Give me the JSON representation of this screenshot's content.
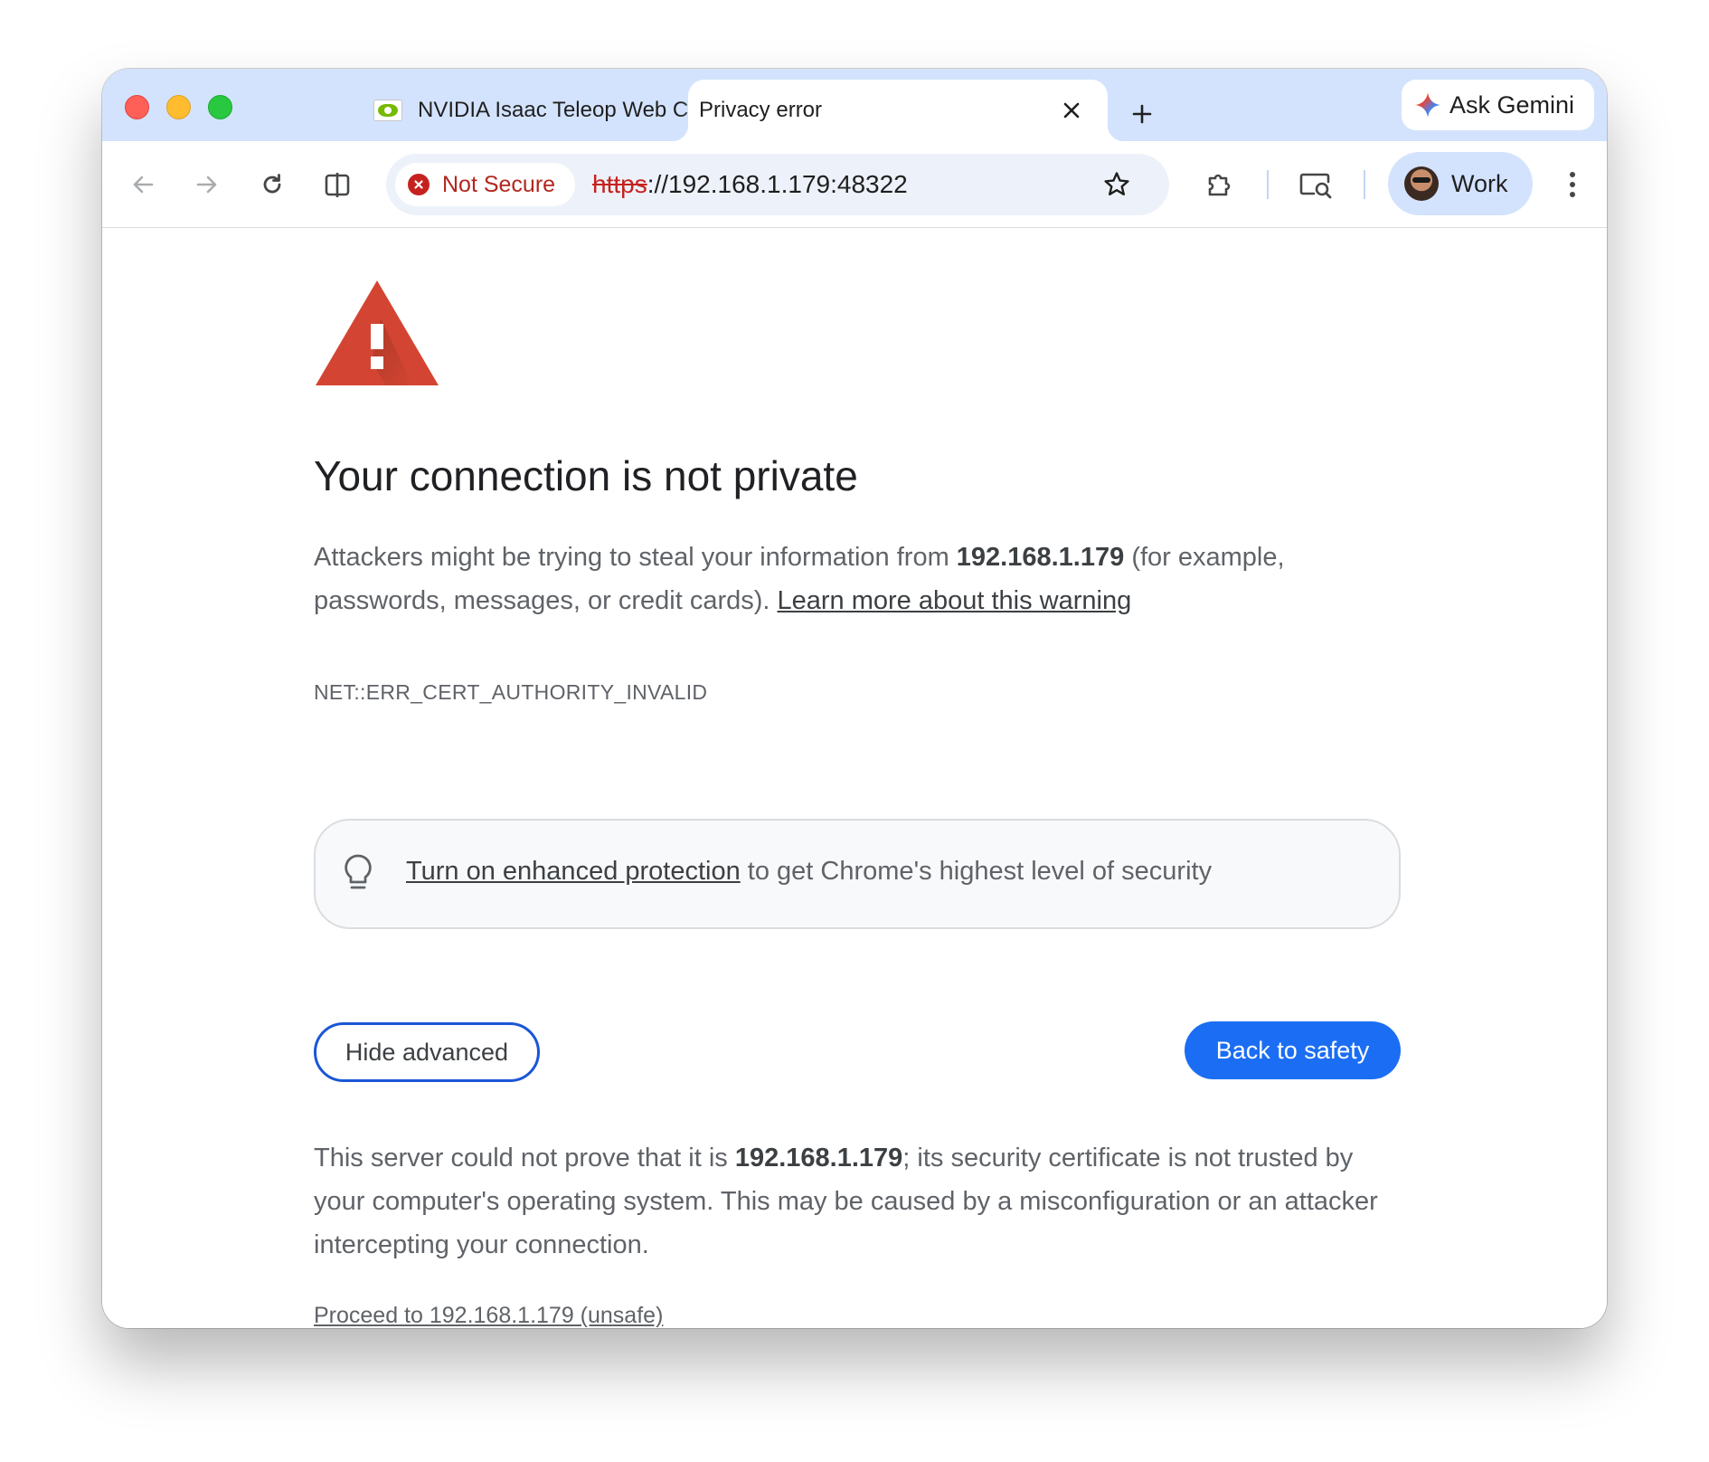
{
  "tabs": [
    {
      "title": "NVIDIA Isaac Teleop Web Client",
      "favicon": "nvidia-icon",
      "active": false
    },
    {
      "title": "Privacy error",
      "active": true
    }
  ],
  "new_tab_icon": "plus-icon",
  "gemini_button": {
    "label": "Ask Gemini",
    "icon": "gemini-sparkle-icon"
  },
  "toolbar": {
    "security_chip": "Not Secure",
    "url_scheme": "https",
    "url_rest": "://192.168.1.179:48322",
    "profile_label": "Work"
  },
  "page": {
    "heading": "Your connection is not private",
    "intro_before": "Attackers might be trying to steal your information from ",
    "intro_host": "192.168.1.179",
    "intro_after": " (for example, passwords, messages, or credit cards). ",
    "learn_more": "Learn more about this warning",
    "error_code": "NET::ERR_CERT_AUTHORITY_INVALID",
    "enhanced_link": "Turn on enhanced protection",
    "enhanced_rest": " to get Chrome's highest level of security",
    "hide_advanced": "Hide advanced",
    "back_to_safety": "Back to safety",
    "detail_before": "This server could not prove that it is ",
    "detail_host": "192.168.1.179",
    "detail_after": "; its security certificate is not trusted by your computer's operating system. This may be caused by a misconfiguration or an attacker intercepting your connection.",
    "proceed_link": "Proceed to 192.168.1.179 (unsafe)"
  },
  "colors": {
    "tabstrip": "#d3e3fd",
    "warning_red": "#d34532",
    "primary_blue": "#1b6ef3",
    "not_secure_red": "#b3261e"
  }
}
